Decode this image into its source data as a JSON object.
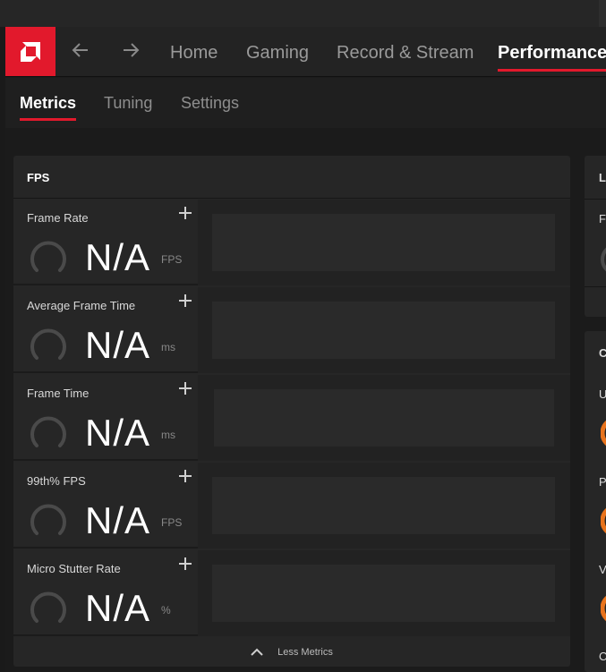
{
  "nav": {
    "tabs": [
      {
        "label": "Home"
      },
      {
        "label": "Gaming"
      },
      {
        "label": "Record & Stream"
      },
      {
        "label": "Performance"
      }
    ]
  },
  "subnav": {
    "tabs": [
      {
        "label": "Metrics"
      },
      {
        "label": "Tuning"
      },
      {
        "label": "Settings"
      }
    ]
  },
  "fps_panel": {
    "title": "FPS",
    "metrics": [
      {
        "title": "Frame Rate",
        "value": "N/A",
        "unit": "FPS"
      },
      {
        "title": "Average Frame Time",
        "value": "N/A",
        "unit": "ms"
      },
      {
        "title": "Frame Time",
        "value": "N/A",
        "unit": "ms"
      },
      {
        "title": "99th% FPS",
        "value": "N/A",
        "unit": "FPS"
      },
      {
        "title": "Micro Stutter Rate",
        "value": "N/A",
        "unit": "%"
      }
    ],
    "less_metrics_label": "Less Metrics"
  },
  "side_panels": {
    "top_header_letter": "L",
    "top_item_letter": "F",
    "bottom_header_letter": "C",
    "items": [
      "U",
      "P",
      "V"
    ],
    "footer_letter": "C"
  },
  "colors": {
    "accent": "#e2192c",
    "gauge_active": "#e8731c",
    "gauge_inactive": "#4a4a4a"
  },
  "icons": {
    "logo": "amd-logo-icon",
    "back": "arrow-left-icon",
    "forward": "arrow-right-icon",
    "add": "plus-icon",
    "collapse": "chevron-up-icon"
  }
}
